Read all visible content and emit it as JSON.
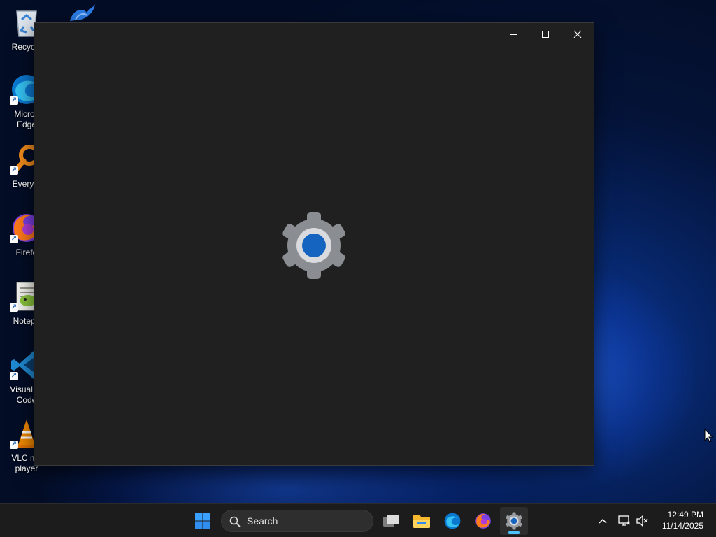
{
  "desktop": {
    "icons": [
      {
        "label": "Recycle",
        "icon": "recycle-bin-icon"
      },
      {
        "label": "Micros\nEdge",
        "icon": "edge-icon"
      },
      {
        "label": "Everyth",
        "icon": "everything-search-icon"
      },
      {
        "label": "Firefo",
        "icon": "firefox-icon"
      },
      {
        "label": "Notepa",
        "icon": "notepad-plus-plus-icon"
      },
      {
        "label": "Visual St\nCode",
        "icon": "vscode-icon"
      },
      {
        "label": "VLC me\nplayer",
        "icon": "vlc-icon"
      }
    ],
    "partial_icon": "swan-app-icon"
  },
  "window": {
    "controls": [
      "minimize",
      "maximize",
      "close"
    ],
    "splash_icon": "settings-gear-icon",
    "colors": {
      "background": "#202020",
      "gear": "#8a8d91",
      "gear_center": "#1565c0"
    }
  },
  "taskbar": {
    "search": {
      "placeholder": "Search"
    },
    "apps": [
      {
        "name": "start",
        "icon": "windows-start-icon"
      },
      {
        "name": "task-view",
        "icon": "task-view-icon"
      },
      {
        "name": "file-explorer",
        "icon": "folder-icon"
      },
      {
        "name": "edge",
        "icon": "edge-icon"
      },
      {
        "name": "firefox",
        "icon": "firefox-icon"
      },
      {
        "name": "settings",
        "icon": "settings-gear-icon",
        "active": true
      }
    ],
    "tray": {
      "time": "12:49 PM",
      "date": "11/14/2025"
    }
  }
}
